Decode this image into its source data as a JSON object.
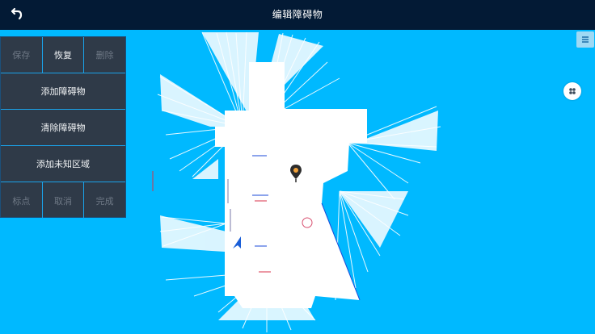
{
  "header": {
    "title": "编辑障碍物",
    "back_icon": "back-arrow-icon"
  },
  "toolbar": {
    "top_row": [
      {
        "label": "保存",
        "enabled": false
      },
      {
        "label": "恢复",
        "enabled": true
      },
      {
        "label": "删除",
        "enabled": false
      }
    ],
    "add_obstacle": "添加障碍物",
    "clear_obstacle": "清除障碍物",
    "add_unknown_area": "添加未知区域",
    "bottom_row": [
      {
        "label": "标点",
        "enabled": false
      },
      {
        "label": "取消",
        "enabled": false
      },
      {
        "label": "完成",
        "enabled": false
      }
    ]
  },
  "map": {
    "background_color": "#00b9ff",
    "free_space_color": "#ffffff",
    "markers": [
      "location-pin-icon",
      "robot-arrow-icon"
    ]
  },
  "controls": {
    "menu_icon": "hamburger-menu-icon",
    "layer_icon": "grid-layer-icon"
  },
  "colors": {
    "header_bg": "#031a35",
    "panel_bg": "#2f3a48",
    "accent": "#1aa3ea",
    "pin": "#f2a23a"
  }
}
